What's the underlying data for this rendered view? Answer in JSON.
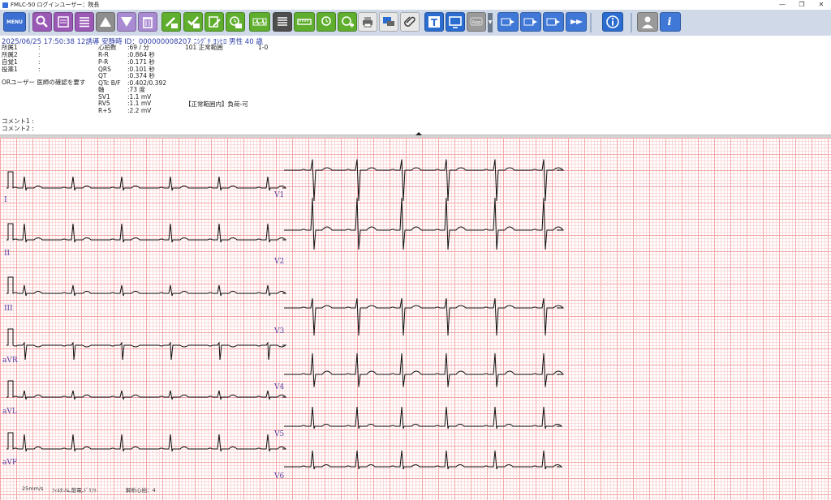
{
  "window": {
    "title": "FMLC-50 ログインユーザー：院長",
    "minimize": "—",
    "restore": "❐",
    "close": "✕"
  },
  "toolbar": {
    "menu_label": "MENU"
  },
  "patient_line": "2025/06/25 17:50:38 12誘導 安静時 ID：000000008207 ﾆｼｸﾞﾁ ﾖｼﾋﾛ 男性 40 歳",
  "left_fields": {
    "shozoku1": "所属1",
    "shozoku2": "所属2",
    "jikaku1": "自覚1",
    "touyaku1": "投薬1",
    "colon": ":",
    "or_user": "ORユーザー 医師の確認を要す"
  },
  "measurements": [
    {
      "label": "心拍数",
      "value": ":69 / 分"
    },
    {
      "label": "R-R",
      "value": ":0.864 秒"
    },
    {
      "label": "P-R",
      "value": ":0.171 秒"
    },
    {
      "label": "QRS",
      "value": ":0.101 秒"
    },
    {
      "label": "QT",
      "value": ":0.374 秒"
    },
    {
      "label": "QTc B/F",
      "value": ":0.402/0.392"
    },
    {
      "label": "軸",
      "value": ":73 度"
    },
    {
      "label": "SV1",
      "value": ":1.1 mV"
    },
    {
      "label": "RV5",
      "value": ":1.1 mV"
    },
    {
      "label": "R+S",
      "value": ":2.2 mV"
    }
  ],
  "diagnosis": {
    "code_text": "101 正常範囲",
    "class": "1-0",
    "summary": "【正常範囲内】負荷-可"
  },
  "comments": {
    "c1": "コメント1 :",
    "c2": "コメント2 :"
  },
  "leads": {
    "I": "I",
    "II": "II",
    "III": "III",
    "aVR": "aVR",
    "aVL": "aVL",
    "aVF": "aVF",
    "V1": "V1",
    "V2": "V2",
    "V3": "V3",
    "V4": "V4",
    "V5": "V5",
    "V6": "V6"
  },
  "footer": {
    "speed": "25mm/s",
    "filter": "ﾌｨﾙﾀ:ﾊﾑ,筋電,ﾄﾞﾘﾌﾄ",
    "beats": "解析心拍：4"
  },
  "colors": {
    "toolbar_bg": "#cfd9e8",
    "patient_text": "#2e3fa8",
    "grid_major": "#f3a7a7",
    "grid_minor": "#fbdada",
    "trace": "#111111",
    "lead_label": "#5a3da0"
  }
}
